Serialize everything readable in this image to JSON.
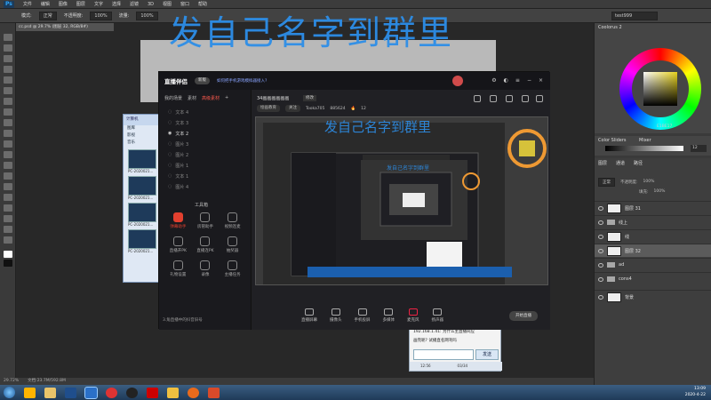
{
  "photoshop": {
    "logo": "Ps",
    "menus": [
      "文件",
      "编辑",
      "图像",
      "图层",
      "文字",
      "选择",
      "滤镜",
      "3D",
      "视图",
      "窗口",
      "帮助"
    ],
    "options": {
      "mode_label": "模式:",
      "mode_value": "正常",
      "opacity_label": "不透明度:",
      "opacity_value": "100%",
      "flow_label": "流量:",
      "flow_value": "100%",
      "workspace_value": "test999"
    },
    "doc_tab": "cc.psd @ 29.7% (图层 32, RGB/8#)",
    "status": {
      "zoom": "29.72%",
      "doc": "文档:23.7M/592.8M"
    }
  },
  "right_panels": {
    "colorwheel_title": "Coolorus 2",
    "color_hex": "E1BE17",
    "sliders_tab": "Color Sliders",
    "mixer_tab": "Mixer",
    "slider_value": "12",
    "layers_tabs": [
      "图层",
      "通道",
      "路径"
    ],
    "blend_mode": "正常",
    "opacity_label": "不透明度:",
    "opacity_value": "100%",
    "fill_label": "填充:",
    "fill_value": "100%",
    "layers": [
      {
        "name": "图层 31",
        "type": "layer",
        "selected": false
      },
      {
        "name": "线上",
        "type": "folder",
        "selected": false
      },
      {
        "name": "线",
        "type": "layer",
        "selected": false
      },
      {
        "name": "图层 32",
        "type": "layer",
        "selected": true
      },
      {
        "name": "ad",
        "type": "folder",
        "selected": false
      },
      {
        "name": "cons4",
        "type": "folder",
        "selected": false
      },
      {
        "name": "背景",
        "type": "layer",
        "selected": false
      }
    ]
  },
  "overlay": {
    "main_text": "发自己名字到群里",
    "mid_text": "发自己名字到群里",
    "small_text": "发自己名字到群里"
  },
  "stream_app": {
    "logo": "直播伴侣",
    "badge": "新版",
    "notice": "如何把手机游戏模拟器接入?",
    "left_tabs": [
      "我的场景",
      "素材",
      "高级素材"
    ],
    "scenes": [
      {
        "name": "文本 4",
        "visible": false
      },
      {
        "name": "文本 3",
        "visible": false
      },
      {
        "name": "文本 2",
        "visible": true
      },
      {
        "name": "图片 3",
        "visible": false
      },
      {
        "name": "图片 2",
        "visible": false
      },
      {
        "name": "图片 1",
        "visible": false
      },
      {
        "name": "文本 1",
        "visible": false
      },
      {
        "name": "图片 4",
        "visible": false
      }
    ],
    "tools_title": "工具箱",
    "tools": [
      {
        "label": "弹幕助手",
        "active": true
      },
      {
        "label": "房管助手",
        "active": false
      },
      {
        "label": "视频连麦",
        "active": false
      },
      {
        "label": "直播开PK",
        "active": false
      },
      {
        "label": "直播连PK",
        "active": false
      },
      {
        "label": "抽奖器",
        "active": false
      },
      {
        "label": "礼物设置",
        "active": false
      },
      {
        "label": "录像",
        "active": false
      },
      {
        "label": "主播任务",
        "active": false
      }
    ],
    "footer": "3.角直播中的抖音旧号",
    "room": {
      "title": "34画画画画画画",
      "tag": "修改",
      "category": "绘画教育",
      "follow": "关注",
      "id_text": "Tooka705",
      "fans": "885624",
      "hot": "12"
    },
    "bottom_controls": [
      "直播屏幕",
      "摄像头",
      "手机投屏",
      "多媒体",
      "麦克风",
      "扬声器"
    ],
    "start_button": "开始直播"
  },
  "file_window": {
    "header": "计算机",
    "nav": [
      "图库",
      "影视",
      "音乐"
    ],
    "files": [
      "PC-2020021...",
      "PC-2020021...",
      "PC-2020021...",
      "PC-2020021..."
    ]
  },
  "chat_window": {
    "lines": [
      "192.168.1.41: 为什么主直播间应",
      "画完呢? 试播直名网刊吗"
    ],
    "send": "发送",
    "tab_left": "12:56",
    "tab_right": "03/34"
  },
  "taskbar": {
    "apps": [
      "qq",
      "folder",
      "ps",
      "ps-active",
      "chrome",
      "recorder",
      "live",
      "folder",
      "firefox",
      "office"
    ],
    "time": "13:09",
    "date": "2020-4-22"
  }
}
